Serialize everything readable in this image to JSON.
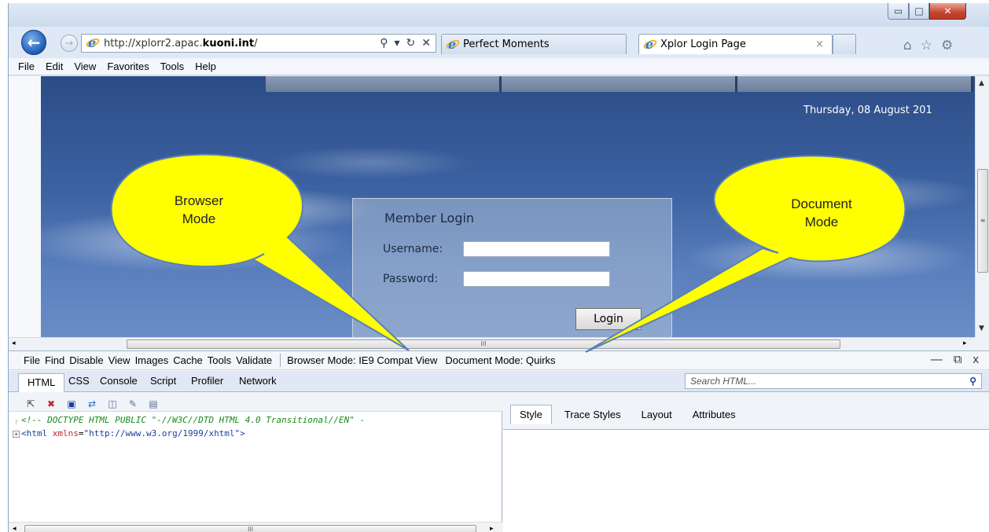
{
  "window": {
    "controls": {
      "minimize": "▭",
      "maximize": "□",
      "close": "✕"
    }
  },
  "nav": {
    "back_icon": "back-arrow-icon",
    "forward_icon": "forward-arrow-icon",
    "address_prefix": "http://xplorr2.apac.",
    "address_domain": "kuoni.int",
    "address_suffix": "/",
    "address_tools": {
      "search": "⚲",
      "dropdown": "▾",
      "refresh": "↻",
      "stop": "✕"
    }
  },
  "tabs": [
    {
      "label": "Perfect Moments",
      "active": false
    },
    {
      "label": "Xplor Login Page",
      "active": true,
      "close": "×"
    }
  ],
  "toolbar_icons": {
    "home": "⌂",
    "favorites": "☆",
    "tools": "⚙"
  },
  "menubar": [
    "File",
    "Edit",
    "View",
    "Favorites",
    "Tools",
    "Help"
  ],
  "page": {
    "date": "Thursday, 08 August 201",
    "login": {
      "title": "Member Login",
      "username_label": "Username:",
      "password_label": "Password:",
      "username_value": "",
      "password_value": "",
      "button": "Login"
    }
  },
  "devtools": {
    "menu": [
      "File",
      "Find",
      "Disable",
      "View",
      "Images",
      "Cache",
      "Tools",
      "Validate"
    ],
    "browser_mode": "Browser Mode: IE9 Compat View",
    "document_mode": "Document Mode: Quirks",
    "window_controls": {
      "minimize": "—",
      "restore": "⧉",
      "close": "x"
    },
    "tabs": [
      "HTML",
      "CSS",
      "Console",
      "Script",
      "Profiler",
      "Network"
    ],
    "search_placeholder": "Search HTML...",
    "tree": {
      "doctype": "<!-- DOCTYPE HTML PUBLIC \"-//W3C//DTD HTML 4.0 Transitional//EN\" -",
      "html_open": "<html ",
      "attr_name": "xmlns",
      "attr_eq": "=",
      "attr_value": "\"http://www.w3.org/1999/xhtml\"",
      "html_close": ">"
    },
    "right_tabs": [
      "Style",
      "Trace Styles",
      "Layout",
      "Attributes"
    ]
  },
  "callouts": {
    "browser_mode": {
      "line1": "Browser",
      "line2": "Mode"
    },
    "document_mode": {
      "line1": "Document",
      "line2": "Mode"
    },
    "fill_color": "#ffff00",
    "stroke_color": "#5a80b8"
  },
  "scroll_grip": "III"
}
